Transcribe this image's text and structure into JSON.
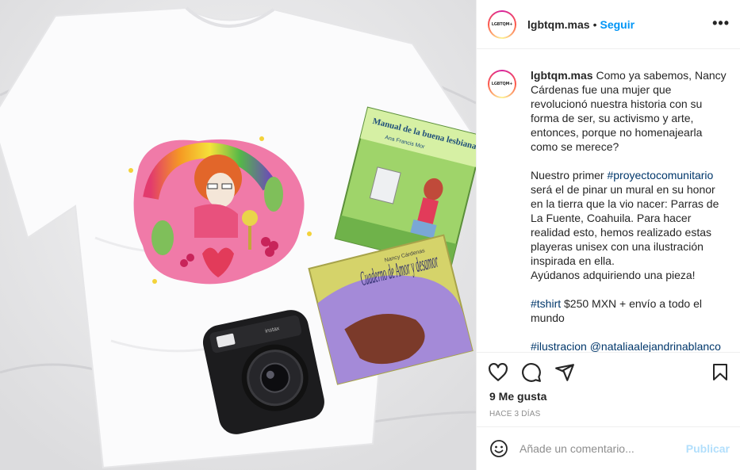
{
  "header": {
    "username": "lgbtqm.mas",
    "separator": "•",
    "follow_label": "Seguir",
    "more_label": "•••",
    "avatar_text": "LGBTQM+"
  },
  "caption": {
    "username": "lgbtqm.mas",
    "para1": "Como ya sabemos, Nancy Cárdenas fue una mujer que revolucionó nuestra historia con su forma de ser, su activismo y arte, entonces, porque no homenajearla como se merece?",
    "para2_a": "Nuestro primer ",
    "hashtag_proyecto": "#proyectocomunitario",
    "para2_b": " será el de pinar un mural en su honor en la tierra que la vio nacer: Parras de La Fuente, Coahuila. Para hacer realidad esto, hemos realizado estas playeras unisex con una ilustración inspirada en ella.",
    "para2_c": "Ayúdanos adquiriendo una pieza!",
    "hashtag_tshirt": "#tshirt",
    "para3": " $250 MXN + envío a todo el mundo",
    "hashtag_ilustracion": "#ilustracion",
    "mention": "@nataliaalejandrinablanco"
  },
  "photo": {
    "book1_title": "Manual de la buena lesbiana",
    "book1_author": "Ana Francis Mor",
    "book2_title": "Cuaderno de Amor y desamor",
    "book2_author": "Nancy Cárdenas",
    "camera_brand": "instax"
  },
  "actions": {
    "likes": "9 Me gusta",
    "time_ago": "HACE 3 DÍAS",
    "icons": [
      "heart-icon",
      "comment-icon",
      "share-icon",
      "bookmark-icon"
    ]
  },
  "comment": {
    "placeholder": "Añade un comentario...",
    "publish_label": "Publicar"
  },
  "colors": {
    "link_blue": "#0095f6",
    "hashtag_blue": "#00376b",
    "publish_disabled": "#b2dffc",
    "muted_gray": "#8e8e8e"
  }
}
